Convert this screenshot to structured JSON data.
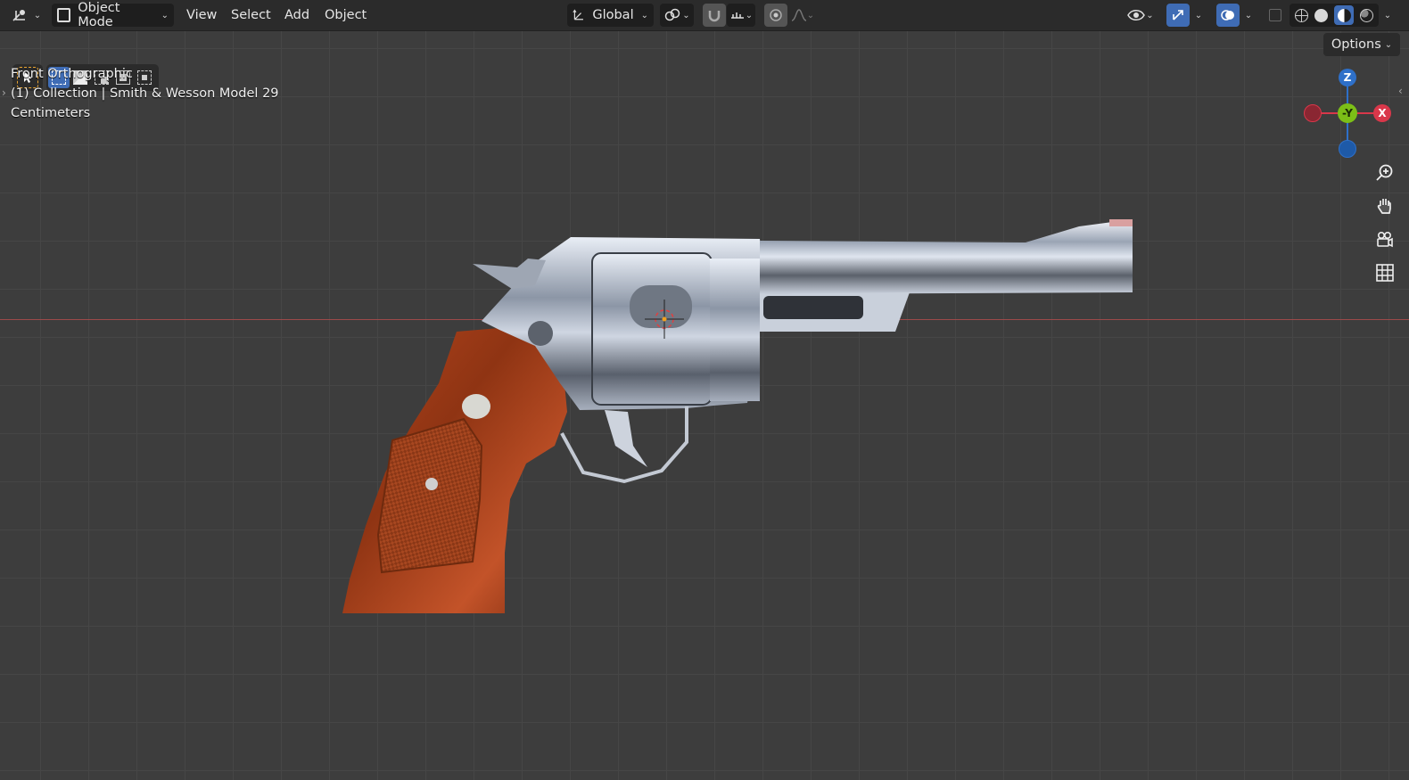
{
  "header": {
    "mode_label": "Object Mode",
    "menu": [
      "View",
      "Select",
      "Add",
      "Object"
    ],
    "orientation_label": "Global",
    "options_label": "Options"
  },
  "viewport": {
    "view_name": "Front Orthographic",
    "collection_line": "(1) Collection | Smith & Wesson Model 29",
    "units": "Centimeters"
  },
  "gizmo": {
    "z_label": "Z",
    "y_label": "-Y",
    "x_label": "X"
  },
  "icons": {
    "editor_type": "transform-gizmo-icon",
    "zoom": "zoom-in-icon",
    "pan": "hand-icon",
    "camera": "camera-icon",
    "grid": "grid-icon"
  },
  "colors": {
    "accent": "#3f6cb5",
    "axis_x": "#d9374a",
    "axis_y": "#7cbf17",
    "axis_z": "#2e70c9"
  }
}
